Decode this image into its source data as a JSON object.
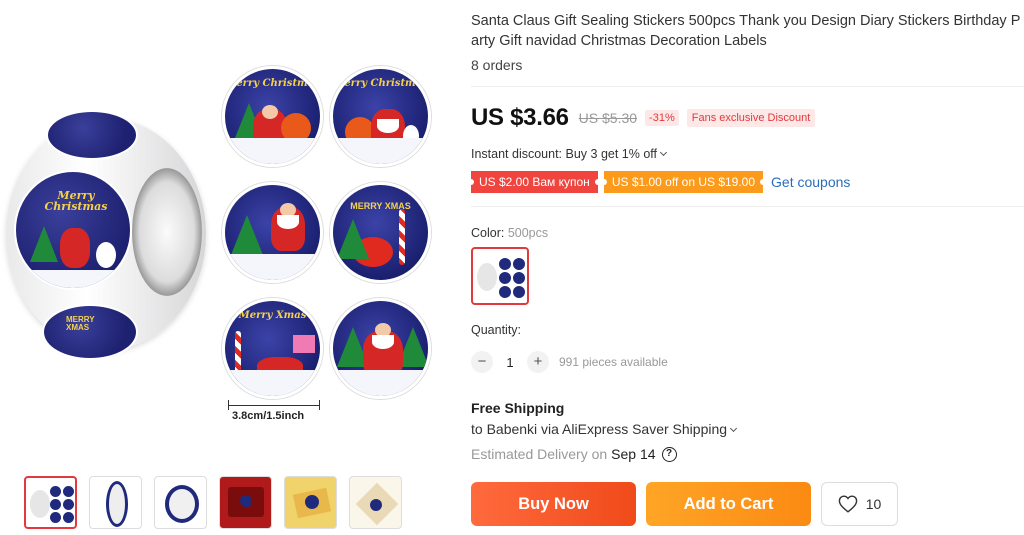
{
  "product": {
    "title": "Santa Claus Gift Sealing Stickers 500pcs Thank you Design Diary Stickers Birthday Party Gift navidad Christmas Decoration Labels",
    "orders": "8 orders"
  },
  "gallery": {
    "sticker_texts": [
      "Merry Christmas",
      "Merry Christmas",
      "",
      "MERRY XMAS",
      "Merry Xmas",
      ""
    ],
    "roll_text": "Merry Christmas",
    "roll_text_bottom": "MERRY XMAS",
    "ruler_label": "3.8cm/1.5inch",
    "thumbnail_count": 6
  },
  "pricing": {
    "price": "US $3.66",
    "original_price": "US $5.30",
    "discount": "-31%",
    "fans_badge": "Fans exclusive Discount",
    "instant_discount": "Instant discount: Buy 3 get 1% off"
  },
  "coupons": {
    "coupon1": "US $2.00 Вам купон",
    "coupon2": "US $1.00 off on US $19.00",
    "get_coupons": "Get coupons"
  },
  "variant": {
    "color_label": "Color:",
    "color_value": "500pcs"
  },
  "quantity": {
    "label": "Quantity:",
    "minus": "−",
    "value": "1",
    "plus": "+",
    "available": "991 pieces available"
  },
  "shipping": {
    "title": "Free Shipping",
    "to": "to Babenki via AliExpress Saver Shipping",
    "estimated_label": "Estimated Delivery on",
    "estimated_date": "Sep 14",
    "help": "?"
  },
  "actions": {
    "buy_now": "Buy Now",
    "add_to_cart": "Add to Cart",
    "wishlist_count": "10"
  },
  "colors": {
    "accent_red": "#e4393c",
    "buy_now": "#f04a1a",
    "add_to_cart": "#fb8a12",
    "link": "#2a6ebb"
  }
}
